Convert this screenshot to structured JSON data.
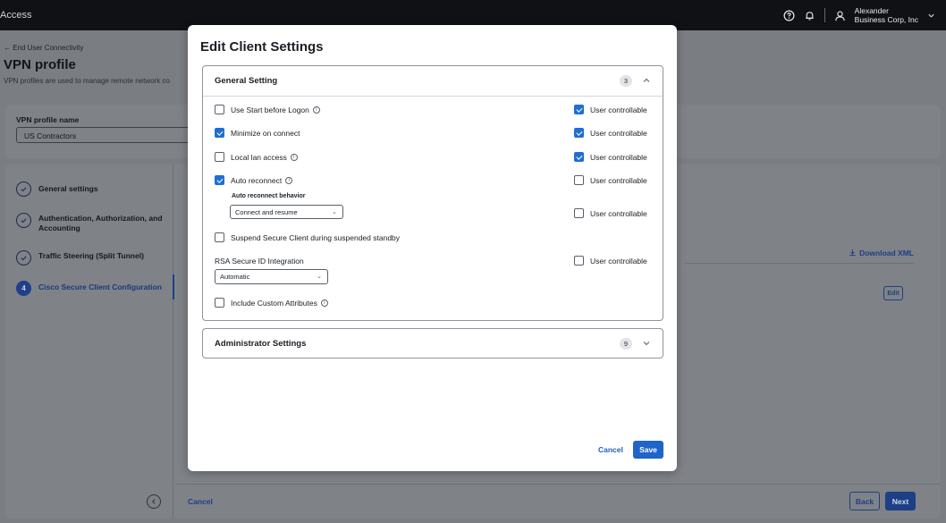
{
  "topbar": {
    "app_title": "Access",
    "user_name": "Alexander",
    "user_org": "Business Corp, Inc"
  },
  "page": {
    "breadcrumb": "← End User Connectivity",
    "title": "VPN profile",
    "description": "VPN profiles are used to manage remote network co",
    "profile_name_label": "VPN profile name",
    "profile_name_value": "US Contractors",
    "download_xml": "Download XML",
    "edit_label": "Edit",
    "steps": [
      {
        "num": "",
        "label": "General settings",
        "state": "done"
      },
      {
        "num": "",
        "label": "Authentication, Authorization, and Accounting",
        "state": "done"
      },
      {
        "num": "",
        "label": "Traffic Steering (Split Tunnel)",
        "state": "done"
      },
      {
        "num": "4",
        "label": "Cisco Secure Client Configuration",
        "state": "active"
      }
    ],
    "footer": {
      "cancel": "Cancel",
      "back": "Back",
      "next": "Next"
    }
  },
  "modal": {
    "title": "Edit Client Settings",
    "general": {
      "title": "General Setting",
      "count": "3",
      "options": [
        {
          "label": "Use Start before Logon",
          "checked": false,
          "info": true,
          "user_controllable": true
        },
        {
          "label": "Minimize on connect",
          "checked": true,
          "info": false,
          "user_controllable": true
        },
        {
          "label": "Local lan access",
          "checked": false,
          "info": true,
          "user_controllable": true
        },
        {
          "label": "Auto reconnect",
          "checked": true,
          "info": true,
          "user_controllable": false
        }
      ],
      "auto_reconnect_behavior_label": "Auto reconnect behavior",
      "auto_reconnect_behavior_value": "Connect and resume",
      "auto_reconnect_user_controllable": false,
      "suspend_label": "Suspend Secure Client during suspended standby",
      "suspend_checked": false,
      "rsa_label": "RSA Secure ID Integration",
      "rsa_value": "Automatic",
      "rsa_user_controllable": false,
      "custom_attr_label": "Include Custom Attributes",
      "custom_attr_checked": false,
      "user_controllable_label": "User controllable"
    },
    "admin": {
      "title": "Administrator Settings",
      "count": "9"
    },
    "cancel": "Cancel",
    "save": "Save"
  },
  "colors": {
    "accent": "#1f64c8",
    "overlay": "#7a7d82",
    "topbar": "#0f1114"
  }
}
